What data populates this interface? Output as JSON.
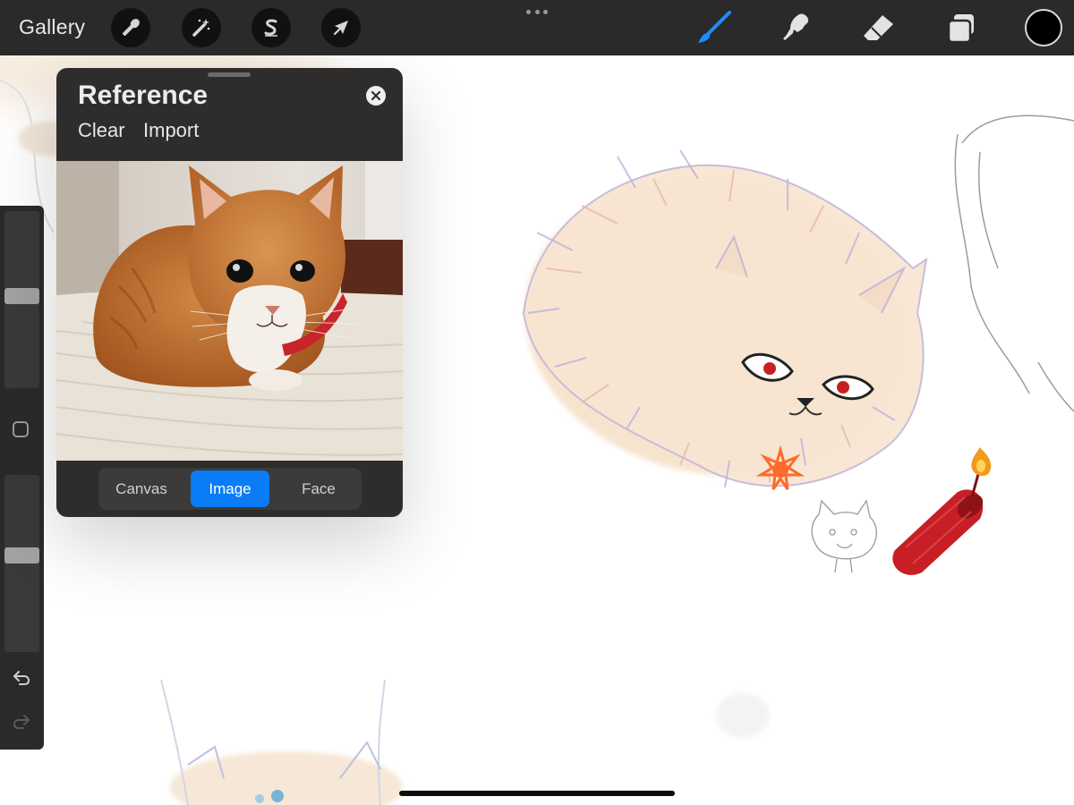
{
  "toolbar": {
    "gallery_label": "Gallery",
    "left_tools": [
      {
        "icon": "wrench-icon",
        "name": "actions"
      },
      {
        "icon": "magic-wand-icon",
        "name": "adjustments"
      },
      {
        "icon": "selection-s-icon",
        "name": "selection"
      },
      {
        "icon": "arrow-cursor-icon",
        "name": "transform"
      }
    ],
    "right_tools": [
      {
        "icon": "brush-icon",
        "name": "brush",
        "active": true
      },
      {
        "icon": "smudge-icon",
        "name": "smudge"
      },
      {
        "icon": "eraser-icon",
        "name": "eraser"
      },
      {
        "icon": "layers-icon",
        "name": "layers"
      }
    ],
    "current_color": "#000000",
    "active_tool_color": "#1e8cff"
  },
  "sidebar": {
    "brush_size_level": 0.52,
    "opacity_level": 0.55
  },
  "reference": {
    "title": "Reference",
    "actions": [
      "Clear",
      "Import"
    ],
    "tabs": [
      {
        "label": "Canvas",
        "active": false
      },
      {
        "label": "Image",
        "active": true
      },
      {
        "label": "Face",
        "active": false
      }
    ],
    "accent_color": "#0a7cf5"
  }
}
